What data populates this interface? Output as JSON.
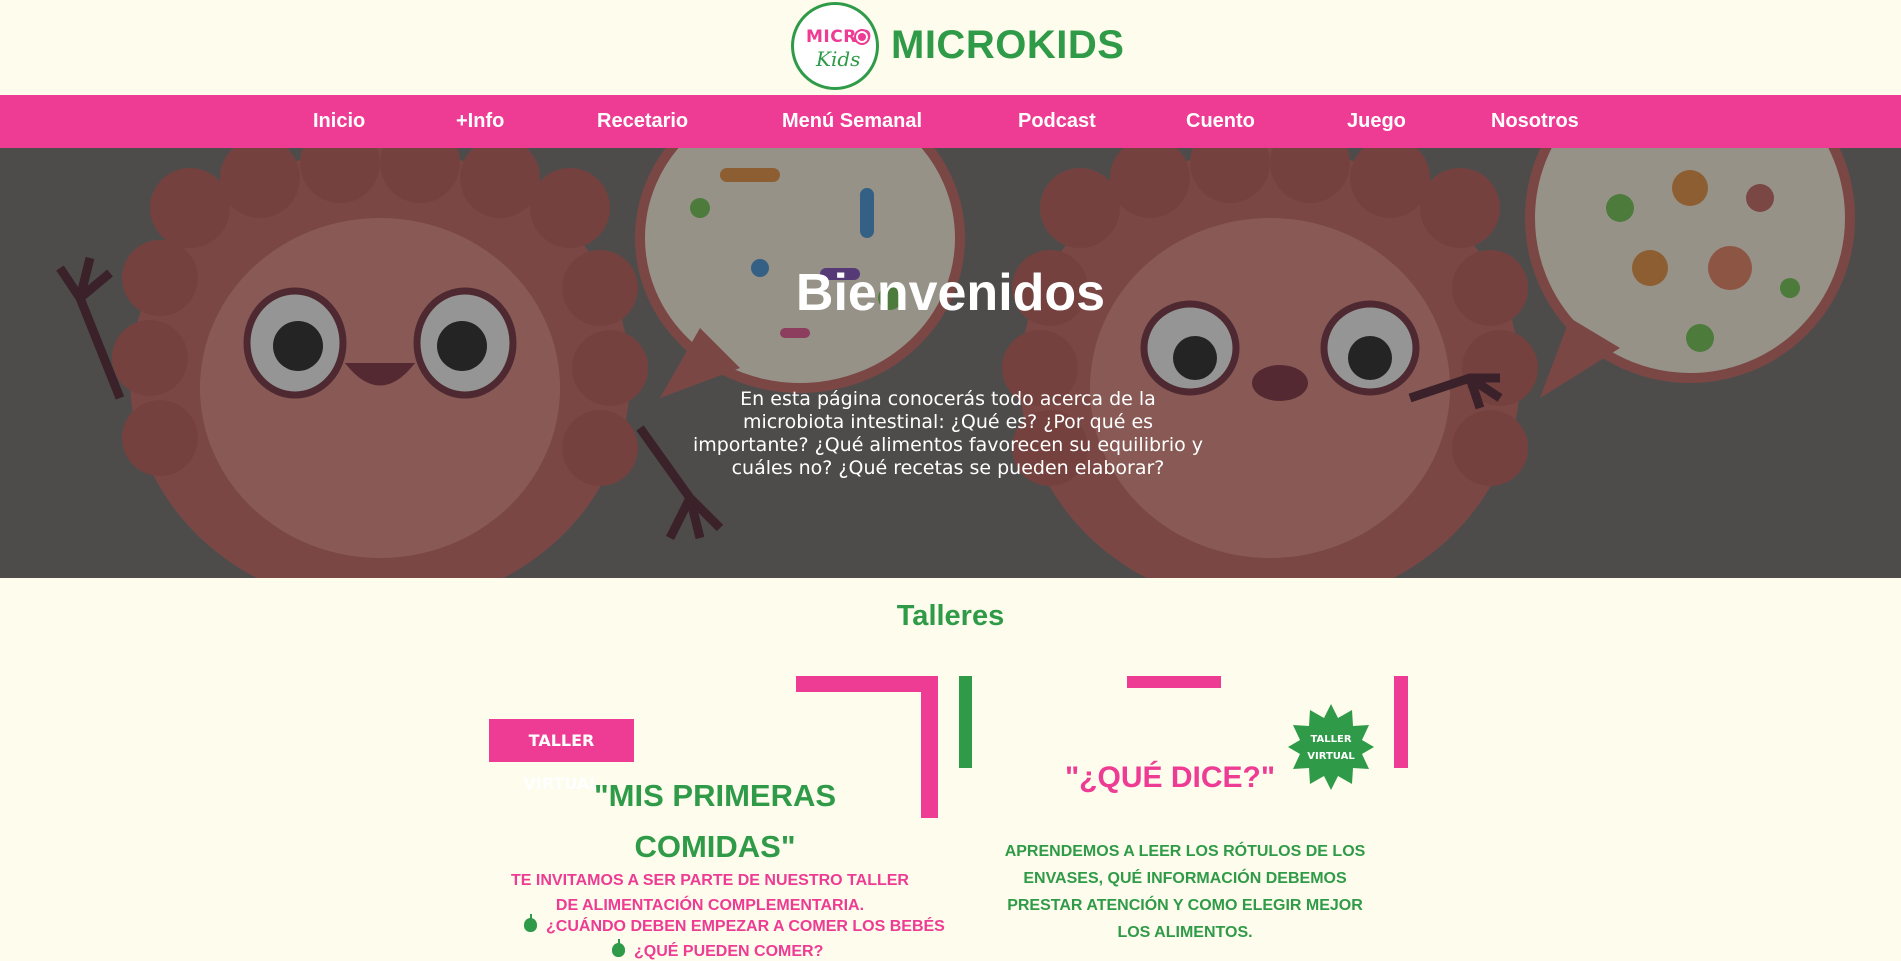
{
  "header": {
    "logo": {
      "micro": "MICRO",
      "kids": "Kids"
    },
    "brand": "MICROKIDS"
  },
  "nav": {
    "items": [
      {
        "label": "Inicio"
      },
      {
        "label": "+Info"
      },
      {
        "label": "Recetario"
      },
      {
        "label": "Menú Semanal"
      },
      {
        "label": "Podcast"
      },
      {
        "label": "Cuento"
      },
      {
        "label": "Juego"
      },
      {
        "label": "Nosotros"
      }
    ]
  },
  "hero": {
    "title": "Bienvenidos",
    "text": "En esta página conocerás todo acerca de la microbiota intestinal: ¿Qué es? ¿Por qué es importante? ¿Qué alimentos favorecen su equilibrio y cuáles no? ¿Qué recetas se pueden elaborar?"
  },
  "talleres": {
    "title": "Talleres",
    "card1": {
      "badge": "TALLER VIRTUAL",
      "title": "\"MIS PRIMERAS COMIDAS\"",
      "text": "TE INVITAMOS A SER PARTE DE NUESTRO TALLER DE ALIMENTACIÓN COMPLEMENTARIA.",
      "questions": [
        "¿CUÁNDO DEBEN EMPEZAR A COMER LOS BEBÉS",
        "¿QUÉ PUEDEN COMER?"
      ]
    },
    "card2": {
      "badge_line1": "TALLER",
      "badge_line2": "VIRTUAL",
      "title": "\"¿QUÉ DICE?\"",
      "text": "APRENDEMOS A LEER LOS RÓTULOS DE LOS ENVASES, QUÉ INFORMACIÓN DEBEMOS PRESTAR ATENCIÓN Y COMO ELEGIR MEJOR LOS ALIMENTOS."
    }
  },
  "colors": {
    "pink": "#ee3b93",
    "green": "#2f9b48",
    "background": "#fefcec"
  }
}
